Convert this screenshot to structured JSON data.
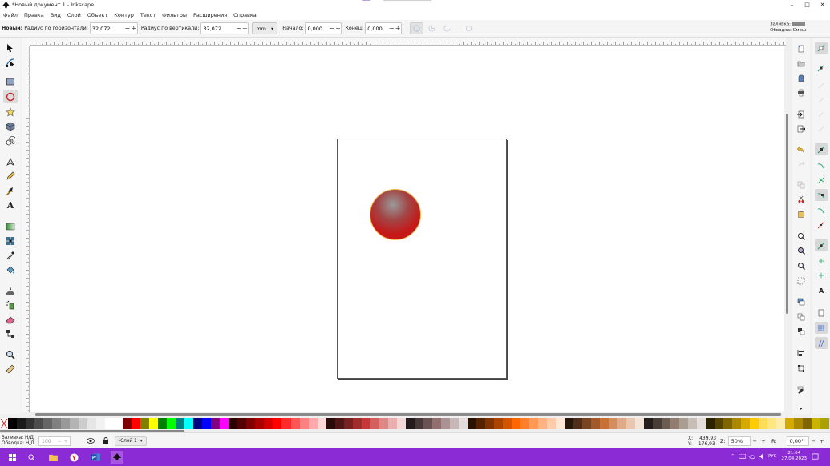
{
  "window": {
    "title": "*Новый документ 1 - Inkscape",
    "buttons": {
      "minimize": "–",
      "maximize": "□",
      "close": "✕"
    }
  },
  "menu": [
    "Файл",
    "Правка",
    "Вид",
    "Слой",
    "Объект",
    "Контур",
    "Текст",
    "Фильтры",
    "Расширения",
    "Справка"
  ],
  "toolbar": {
    "new_label": "Новый:",
    "rx_label": "Радиус по горизонтали:",
    "rx_value": "32,072",
    "ry_label": "Радиус по вертикали:",
    "ry_value": "32,072",
    "unit": "mm",
    "start_label": "Начало:",
    "start_value": "0,000",
    "end_label": "Конец:",
    "end_value": "0,000",
    "plus": "+",
    "minus": "−",
    "fill_label": "Заливка:",
    "stroke_label": "Обводка:",
    "stroke_value": "Смеш"
  },
  "tools": [
    {
      "name": "selector-icon",
      "active": false
    },
    {
      "name": "node-icon",
      "active": false
    },
    {
      "name": "rectangle-icon",
      "active": false
    },
    {
      "name": "ellipse-icon",
      "active": true
    },
    {
      "name": "star-icon",
      "active": false
    },
    {
      "name": "box3d-icon",
      "active": false
    },
    {
      "name": "spiral-icon",
      "active": false
    },
    {
      "name": "pen-icon",
      "active": false
    },
    {
      "name": "pencil-icon",
      "active": false
    },
    {
      "name": "calligraphy-icon",
      "active": false
    },
    {
      "name": "text-icon",
      "active": false
    },
    {
      "name": "gradient-icon",
      "active": false
    },
    {
      "name": "mesh-icon",
      "active": false
    },
    {
      "name": "dropper-icon",
      "active": false
    },
    {
      "name": "paint-bucket-icon",
      "active": false
    },
    {
      "name": "tweak-icon",
      "active": false
    },
    {
      "name": "spray-icon",
      "active": false
    },
    {
      "name": "eraser-icon",
      "active": false
    },
    {
      "name": "connector-icon",
      "active": false
    },
    {
      "name": "zoom-icon",
      "active": false
    },
    {
      "name": "measure-icon",
      "active": false
    }
  ],
  "text_tool_glyph": "A",
  "palette": [
    "#000000",
    "#1a1a1a",
    "#333333",
    "#4d4d4d",
    "#666666",
    "#808080",
    "#999999",
    "#b3b3b3",
    "#cccccc",
    "#e6e6e6",
    "#f2f2f2",
    "#ffffff",
    "#ffffff",
    "#800000",
    "#ff0000",
    "#808000",
    "#ffff00",
    "#008000",
    "#00ff00",
    "#008080",
    "#00ffff",
    "#000080",
    "#0000ff",
    "#800080",
    "#ff00ff",
    "#2b0000",
    "#550000",
    "#800000",
    "#aa0000",
    "#d40000",
    "#ff0000",
    "#ff2a2a",
    "#ff5555",
    "#ff8080",
    "#ffaaaa",
    "#ffd5d5",
    "#280b0b",
    "#501616",
    "#782121",
    "#a02c2c",
    "#c83737",
    "#d35f5f",
    "#de8787",
    "#e9afaf",
    "#f4d7d7",
    "#241c1c",
    "#483737",
    "#6c5353",
    "#916f6f",
    "#ac9393",
    "#c8b7b7",
    "#e3dbdb",
    "#2b1100",
    "#552200",
    "#803300",
    "#aa4400",
    "#d45500",
    "#ff6600",
    "#ff7f2a",
    "#ff9955",
    "#ffb380",
    "#ffccaa",
    "#ffe6d5",
    "#28170b",
    "#502d16",
    "#784421",
    "#a05a2c",
    "#c87137",
    "#d38d5f",
    "#deaa87",
    "#e9c6af",
    "#f4e3d7",
    "#241f1c",
    "#483e37",
    "#6c5d53",
    "#917c6f",
    "#ac9d93",
    "#c8beb7",
    "#e3dedb",
    "#2b2200",
    "#554400",
    "#806600",
    "#aa8800",
    "#d4aa00",
    "#ffcc00",
    "#ffdd55",
    "#ffe680",
    "#ffeeaa",
    "#d4aa00",
    "#aa8800",
    "#806600",
    "#c8b400",
    "#aaa000"
  ],
  "status": {
    "fill_label": "Заливка:",
    "fill_value": "Н/Д",
    "stroke_label": "Обводка:",
    "stroke_value": "Н/Д",
    "opacity": "100",
    "layer": "-Слой 1",
    "x_label": "X:",
    "x_value": "439,93",
    "y_label": "Y:",
    "y_value": "176,93",
    "zoom_label": "Z:",
    "zoom_value": "50%",
    "rotation_label": "R:",
    "rotation_value": "0,00°"
  },
  "taskbar": {
    "lang": "РУС",
    "time": "21:04",
    "date": "27.04.2023"
  },
  "colors": {
    "taskbar": "#8a2bd6",
    "ball_fill": "#c41a1a",
    "ball_stroke": "#f2b54a"
  }
}
